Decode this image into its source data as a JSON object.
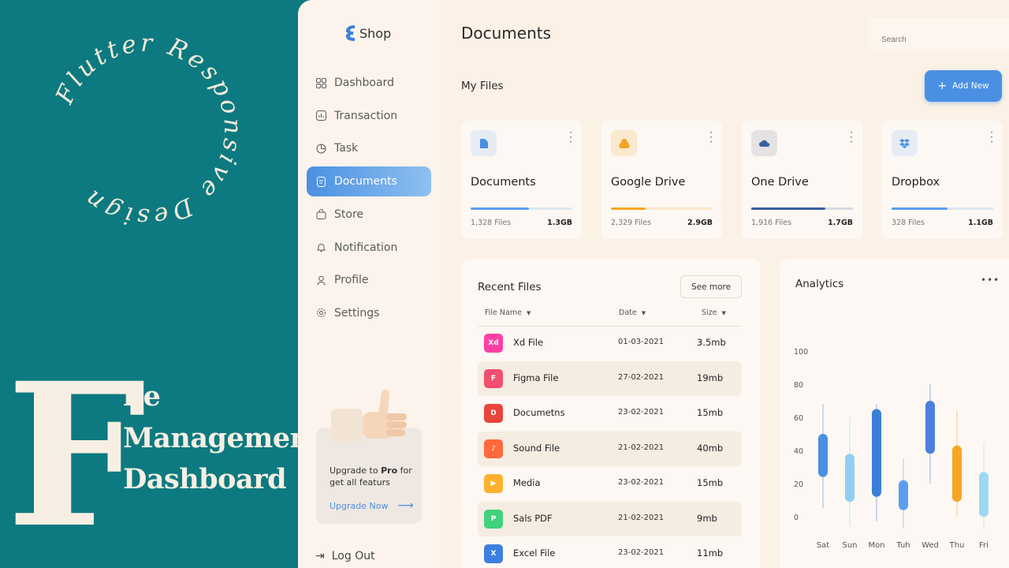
{
  "banner": {
    "circle_text": "Flutter Responsive Design",
    "big_letter": "F",
    "line1": "ile",
    "line2": "Management",
    "line3": "Dashboard"
  },
  "app": {
    "logo_text": "Shop",
    "page_title": "Documents",
    "search_placeholder": "Search"
  },
  "sidebar": {
    "items": [
      {
        "label": "Dashboard",
        "icon": "grid-icon",
        "active": false
      },
      {
        "label": "Transaction",
        "icon": "chart-icon",
        "active": false
      },
      {
        "label": "Task",
        "icon": "pie-icon",
        "active": false
      },
      {
        "label": "Documents",
        "icon": "document-icon",
        "active": true
      },
      {
        "label": "Store",
        "icon": "bag-icon",
        "active": false
      },
      {
        "label": "Notification",
        "icon": "bell-icon",
        "active": false
      },
      {
        "label": "Profile",
        "icon": "user-icon",
        "active": false
      },
      {
        "label": "Settings",
        "icon": "gear-icon",
        "active": false
      }
    ],
    "promo": {
      "text_pre": "Upgrade to ",
      "text_bold": "Pro",
      "text_post": " for get all featurs",
      "link": "Upgrade Now"
    },
    "logout": "Log Out"
  },
  "myfiles": {
    "title": "My Files",
    "add_button": "Add New",
    "cards": [
      {
        "name": "Documents",
        "count": "1,328 Files",
        "size": "1.3GB",
        "progress": 0.57,
        "color": "#5b9ef0",
        "icon": "file-icon",
        "icon_bg": "#e6ecf4"
      },
      {
        "name": "Google Drive",
        "count": "2,329 Files",
        "size": "2.9GB",
        "progress": 0.34,
        "color": "#f4a523",
        "icon": "google-drive-icon",
        "icon_bg": "#fbe9cf"
      },
      {
        "name": "One Drive",
        "count": "1,916 Files",
        "size": "1.7GB",
        "progress": 0.73,
        "color": "#3a5ea0",
        "icon": "cloud-icon",
        "icon_bg": "#e4e2e2"
      },
      {
        "name": "Dropbox",
        "count": "328 Files",
        "size": "1.1GB",
        "progress": 0.55,
        "color": "#5b9ef0",
        "icon": "dropbox-icon",
        "icon_bg": "#e6ecf4"
      }
    ]
  },
  "recent": {
    "title": "Recent Files",
    "see_more": "See more",
    "headers": {
      "name": "File Name",
      "date": "Date",
      "size": "Size"
    },
    "rows": [
      {
        "name": "Xd File",
        "date": "01-03-2021",
        "size": "3.5mb",
        "color": "#ff3fa4",
        "glyph": "Xd",
        "icon": "xd-file-icon"
      },
      {
        "name": "Figma File",
        "date": "27-02-2021",
        "size": "19mb",
        "color": "#f24e6e",
        "glyph": "F",
        "icon": "figma-file-icon"
      },
      {
        "name": "Documetns",
        "date": "23-02-2021",
        "size": "15mb",
        "color": "#e8453c",
        "glyph": "D",
        "icon": "document-file-icon"
      },
      {
        "name": "Sound File",
        "date": "21-02-2021",
        "size": "40mb",
        "color": "#ff6a3c",
        "glyph": "♪",
        "icon": "sound-file-icon"
      },
      {
        "name": "Media",
        "date": "23-02-2021",
        "size": "15mb",
        "color": "#ffb02e",
        "glyph": "▶",
        "icon": "media-file-icon"
      },
      {
        "name": "Sals PDF",
        "date": "21-02-2021",
        "size": "9mb",
        "color": "#3fd17c",
        "glyph": "P",
        "icon": "pdf-file-icon"
      },
      {
        "name": "Excel File",
        "date": "23-02-2021",
        "size": "11mb",
        "color": "#3d7fe0",
        "glyph": "X",
        "icon": "excel-file-icon"
      }
    ]
  },
  "analytics": {
    "title": "Analytics",
    "chart_data": {
      "type": "candlestick",
      "categories": [
        "Sat",
        "Sun",
        "Mon",
        "Tuh",
        "Wed",
        "Thu",
        "Fri"
      ],
      "y_ticks": [
        0,
        20,
        40,
        60,
        80,
        100
      ],
      "ylim": [
        0,
        100
      ],
      "grid": false,
      "candles": [
        {
          "low": 5,
          "open": 24,
          "close": 50,
          "high": 68,
          "color": "#4a8fe0"
        },
        {
          "low": -6,
          "open": 9,
          "close": 38,
          "high": 60,
          "color": "#8fd0f0"
        },
        {
          "low": -3,
          "open": 12,
          "close": 65,
          "high": 68,
          "color": "#3a7fd8"
        },
        {
          "low": -7,
          "open": 4,
          "close": 22,
          "high": 35,
          "color": "#5b9ef0"
        },
        {
          "low": 20,
          "open": 38,
          "close": 70,
          "high": 80,
          "color": "#4a7fe0"
        },
        {
          "low": 0,
          "open": 9,
          "close": 43,
          "high": 64,
          "color": "#f5a623"
        },
        {
          "low": -7,
          "open": 0,
          "close": 27,
          "high": 45,
          "color": "#9dd8f2"
        }
      ]
    }
  },
  "colors": {
    "accent": "#4a90e2",
    "banner_bg": "#0c7a80",
    "app_bg": "#fbf1e6"
  }
}
